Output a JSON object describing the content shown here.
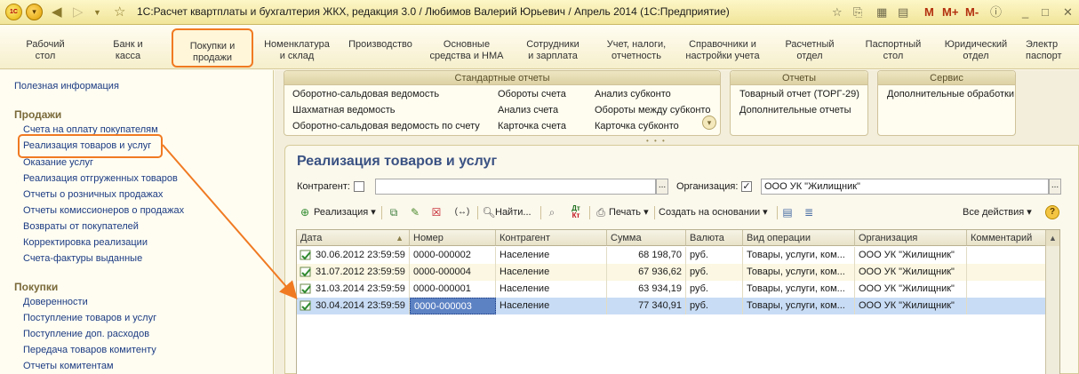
{
  "title": "1С:Расчет квартплаты и бухгалтерия ЖКХ, редакция 3.0 / Любимов Валерий Юрьевич / Апрель 2014  (1С:Предприятие)",
  "titlebar_right": {
    "m": "M",
    "mplus": "M+",
    "mminus": "M-"
  },
  "sections": [
    {
      "l1": "Рабочий",
      "l2": "стол"
    },
    {
      "l1": "Банк и",
      "l2": "касса"
    },
    {
      "l1": "Покупки и",
      "l2": "продажи"
    },
    {
      "l1": "Номенклатура",
      "l2": "и склад"
    },
    {
      "l1": "Производство",
      "l2": ""
    },
    {
      "l1": "Основные",
      "l2": "средства и НМА"
    },
    {
      "l1": "Сотрудники",
      "l2": "и зарплата"
    },
    {
      "l1": "Учет, налоги,",
      "l2": "отчетность"
    },
    {
      "l1": "Справочники и",
      "l2": "настройки учета"
    },
    {
      "l1": "Расчетный",
      "l2": "отдел"
    },
    {
      "l1": "Паспортный",
      "l2": "стол"
    },
    {
      "l1": "Юридический",
      "l2": "отдел"
    },
    {
      "l1": "Электр",
      "l2": "паспорт"
    }
  ],
  "left": {
    "useful": "Полезная информация",
    "sales_group": "Продажи",
    "sales": [
      "Счета на оплату покупателям",
      "Реализация товаров и услуг",
      "Оказание услуг",
      "Реализация отгруженных товаров",
      "Отчеты о розничных продажах",
      "Отчеты комиссионеров о продажах",
      "Возвраты от покупателей",
      "Корректировка реализации",
      "Счета-фактуры выданные"
    ],
    "purchases_group": "Покупки",
    "purchases": [
      "Доверенности",
      "Поступление товаров и услуг",
      "Поступление доп. расходов",
      "Передача товаров комитенту",
      "Отчеты комитентам"
    ]
  },
  "reports": {
    "standard_title": "Стандартные отчеты",
    "standard": [
      "Оборотно-сальдовая ведомость",
      "Шахматная ведомость",
      "Оборотно-сальдовая ведомость по счету",
      "Обороты счета",
      "Анализ счета",
      "Карточка счета",
      "Анализ субконто",
      "Обороты между субконто",
      "Карточка субконто"
    ],
    "reports_title": "Отчеты",
    "reports": [
      "Товарный отчет (ТОРГ-29)",
      "Дополнительные отчеты"
    ],
    "service_title": "Сервис",
    "service": [
      "Дополнительные обработки"
    ]
  },
  "form": {
    "title": "Реализация товаров и услуг",
    "contractor_label": "Контрагент:",
    "contractor_value": "",
    "org_label": "Организация:",
    "org_checked": "✓",
    "org_value": "ООО УК \"Жилищник\"",
    "select_btn": "..."
  },
  "toolbar": {
    "realization": "Реализация",
    "find": "Найти...",
    "print": "Печать",
    "create_based": "Создать на основании",
    "all_actions": "Все действия"
  },
  "table": {
    "headers": [
      "Дата",
      "Номер",
      "Контрагент",
      "Сумма",
      "Валюта",
      "Вид операции",
      "Организация",
      "Комментарий"
    ],
    "rows": [
      [
        "30.06.2012 23:59:59",
        "0000-000002",
        "Население",
        "68 198,70",
        "руб.",
        "Товары, услуги, ком...",
        "ООО УК \"Жилищник\"",
        ""
      ],
      [
        "31.07.2012 23:59:59",
        "0000-000004",
        "Население",
        "67 936,62",
        "руб.",
        "Товары, услуги, ком...",
        "ООО УК \"Жилищник\"",
        ""
      ],
      [
        "31.03.2014 23:59:59",
        "0000-000001",
        "Население",
        "63 934,19",
        "руб.",
        "Товары, услуги, ком...",
        "ООО УК \"Жилищник\"",
        ""
      ],
      [
        "30.04.2014 23:59:59",
        "0000-000003",
        "Население",
        "77 340,91",
        "руб.",
        "Товары, услуги, ком...",
        "ООО УК \"Жилищник\"",
        ""
      ]
    ]
  },
  "colors": {
    "accent": "#f07a22",
    "link": "#1b3b82",
    "selection": "#c8dcf5",
    "title": "#3a5283"
  }
}
